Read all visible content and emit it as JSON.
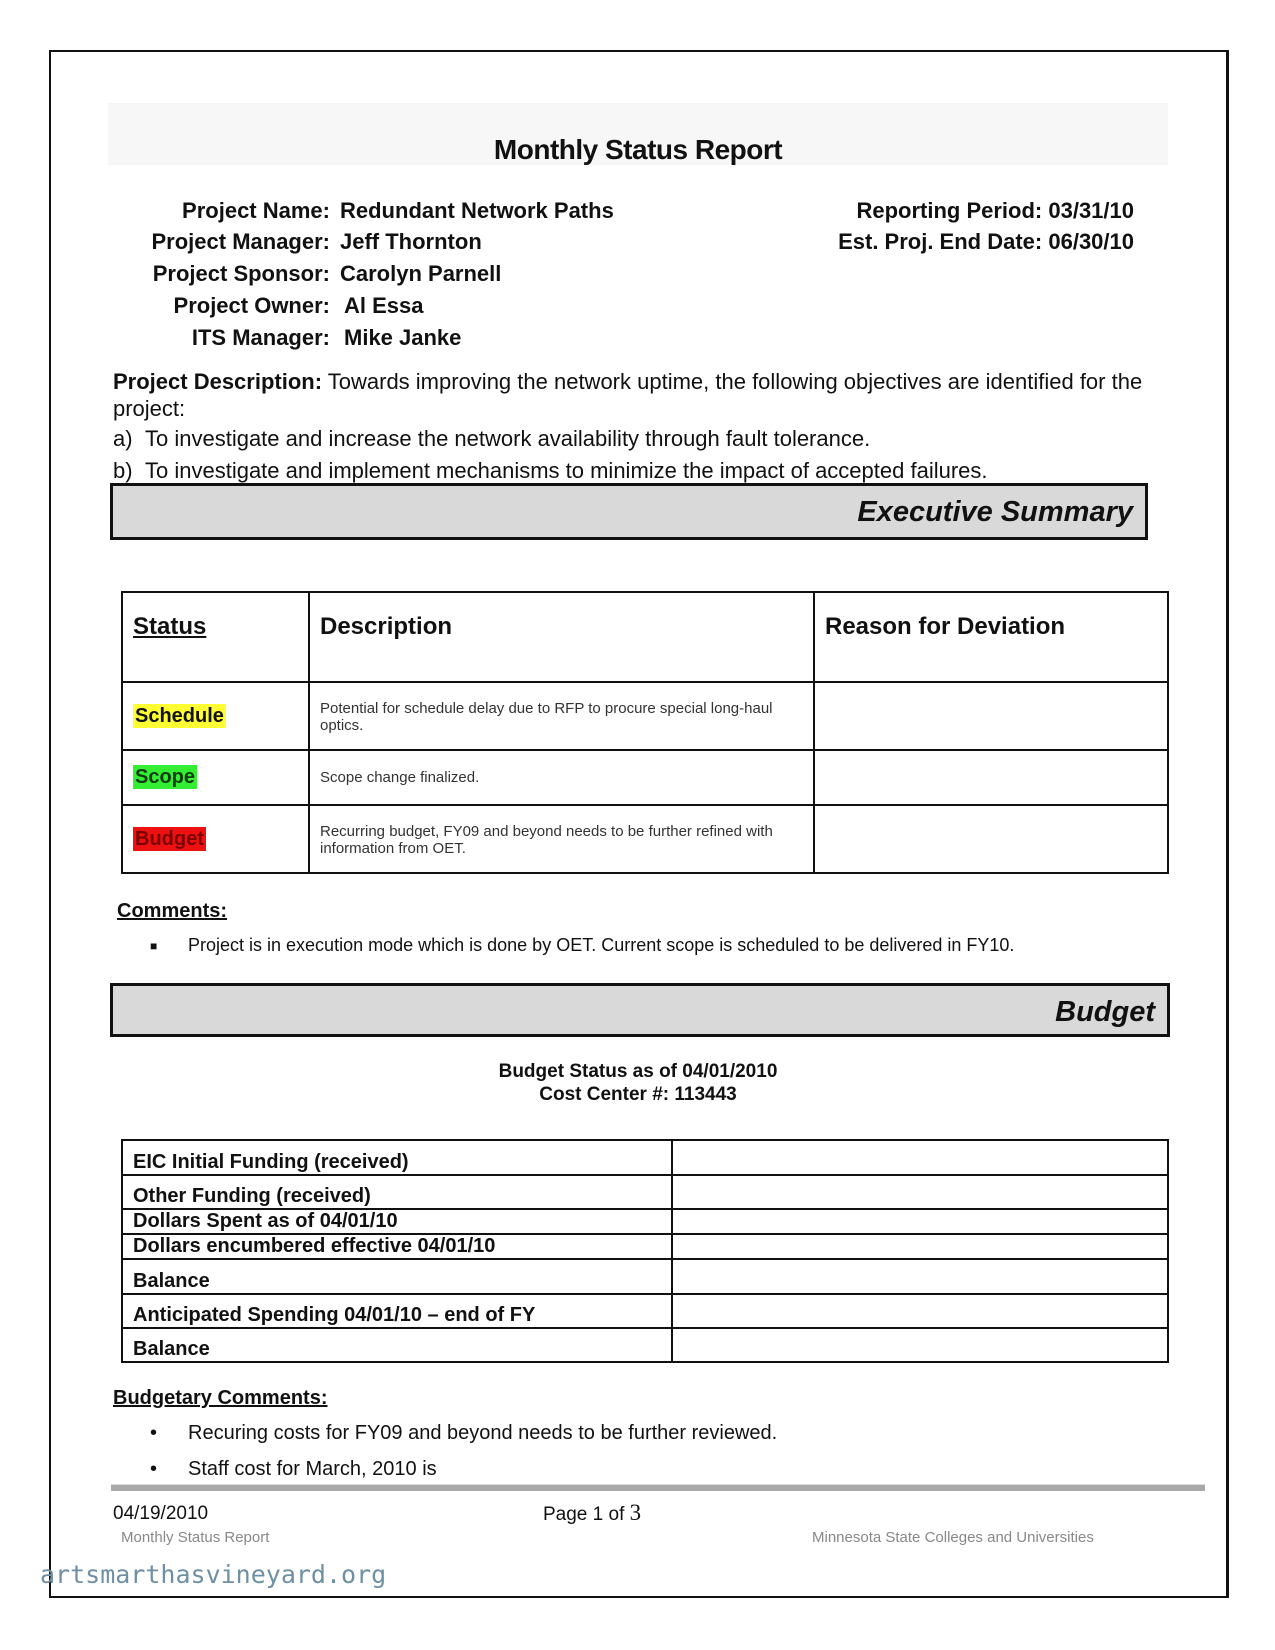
{
  "document": {
    "title": "Monthly Status Report",
    "project_info": [
      {
        "label": "Project Name:",
        "value": "Redundant Network Paths"
      },
      {
        "label": "Project Manager:",
        "value": "Jeff Thornton"
      },
      {
        "label": "Project Sponsor:",
        "value": "Carolyn Parnell"
      },
      {
        "label": "Project Owner:",
        "value": "Al Essa"
      },
      {
        "label": "ITS Manager:",
        "value": "Mike Janke"
      }
    ],
    "reporting_period": {
      "label": "Reporting Period:",
      "value": "03/31/10"
    },
    "est_end_date": {
      "label": "Est. Proj. End Date:",
      "value": "06/30/10"
    },
    "description": {
      "label": "Project Description:",
      "text": "Towards improving the network uptime, the following objectives are identified for the project:",
      "objectives": [
        {
          "mark": "a)",
          "text": "To investigate and increase the network availability through fault tolerance."
        },
        {
          "mark": "b)",
          "text": "To investigate and implement mechanisms to minimize the impact of accepted failures."
        }
      ]
    }
  },
  "executive_summary": {
    "heading": "Executive Summary",
    "columns": [
      "Status",
      "Description",
      "Reason for Deviation"
    ],
    "rows": [
      {
        "status": "Schedule",
        "status_color": "#ffff33",
        "description": "Potential for schedule delay due to RFP to procure special long-haul optics.",
        "reason": ""
      },
      {
        "status": "Scope",
        "status_color": "#33ee33",
        "description": "Scope change finalized.",
        "reason": ""
      },
      {
        "status": "Budget",
        "status_color": "#ee1111",
        "description": "Recurring budget, FY09 and beyond needs to be further refined with information from OET.",
        "reason": ""
      }
    ],
    "comments_heading": "Comments:",
    "comments": [
      "Project is in execution mode which is done by OET.  Current scope is scheduled to be delivered in FY10."
    ]
  },
  "budget": {
    "heading": "Budget",
    "status_line": "Budget Status as of  04/01/2010",
    "cost_center_line": "Cost Center #: 113443",
    "rows": [
      {
        "label": "EIC Initial Funding (received)",
        "value": ""
      },
      {
        "label": "Other Funding (received)",
        "value": ""
      },
      {
        "label": "Dollars Spent as of 04/01/10",
        "value": ""
      },
      {
        "label": "Dollars encumbered effective 04/01/10",
        "value": ""
      },
      {
        "label": "Balance",
        "value": ""
      },
      {
        "label": "Anticipated Spending 04/01/10 – end of FY",
        "value": ""
      },
      {
        "label": "Balance",
        "value": ""
      }
    ],
    "comments_heading": "Budgetary Comments:",
    "comments": [
      "Recuring costs for FY09 and beyond needs to be further reviewed.",
      "Staff cost for March, 2010 is"
    ]
  },
  "footer": {
    "date": "04/19/2010",
    "page_prefix": "Page 1 of ",
    "page_total": "3",
    "doc_name": "Monthly Status Report",
    "organization": "Minnesota State Colleges and Universities"
  },
  "watermark": "artsmarthasvineyard.org"
}
